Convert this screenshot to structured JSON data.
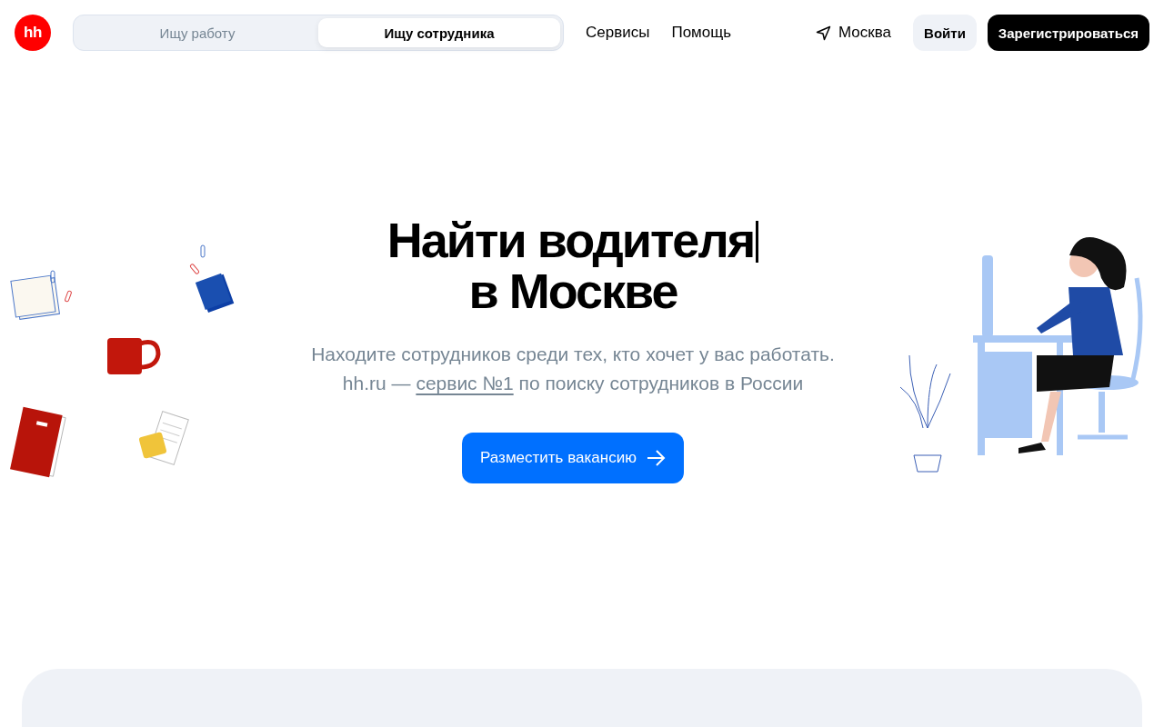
{
  "header": {
    "logo": "hh",
    "role_tabs": [
      {
        "label": "Ищу работу",
        "selected": false
      },
      {
        "label": "Ищу сотрудника",
        "selected": true
      }
    ],
    "nav_links": [
      "Сервисы",
      "Помощь"
    ],
    "city": "Москва",
    "login_button": "Войти",
    "register_button": "Зарегистрироваться"
  },
  "hero": {
    "title_lines": [
      "Найти водителя",
      "в Москве"
    ],
    "text_cursor": true,
    "subtitle_line_1": "Находите сотрудников среди тех, кто хочет у вас работать.",
    "subtitle_prefix": "hh.ru —",
    "subtitle_link": "сервис №1",
    "subtitle_suffix": "по поиску сотрудников в России",
    "cta_button": "Разместить вакансию"
  }
}
